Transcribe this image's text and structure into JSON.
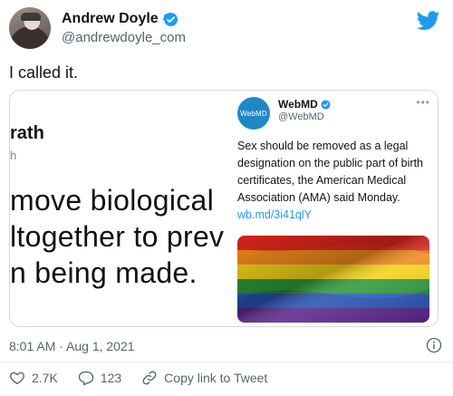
{
  "author": {
    "display_name": "Andrew Doyle",
    "handle": "@andrewdoyle_com",
    "verified_icon": "verified-badge-icon",
    "avatar_icon": "avatar"
  },
  "platform_icon": "twitter-bird-icon",
  "tweet": {
    "text": "I called it."
  },
  "quote_card": {
    "cropped_title": "rath",
    "cropped_sub": "h",
    "cropped_lines": [
      "move biological",
      "ltogether to prev",
      "n being made."
    ],
    "inner_tweet": {
      "logo_text": "WebMD",
      "name": "WebMD",
      "handle": "@WebMD",
      "body": "Sex should be removed as a legal designation on the public part of birth certificates, the American Medical Association (AMA) said Monday.",
      "link": "wb.md/3i41qlY",
      "more_icon": "more-icon",
      "image_description_icon": "rainbow-flag-image"
    }
  },
  "meta": {
    "timestamp": "8:01 AM · Aug 1, 2021",
    "info_icon": "info-icon"
  },
  "actions": {
    "likes": "2.7K",
    "replies": "123",
    "copy_link_label": "Copy link to Tweet"
  },
  "colors": {
    "accent": "#1d9bf0",
    "text_secondary": "#536471",
    "webmd_blue": "#1e88c7"
  }
}
